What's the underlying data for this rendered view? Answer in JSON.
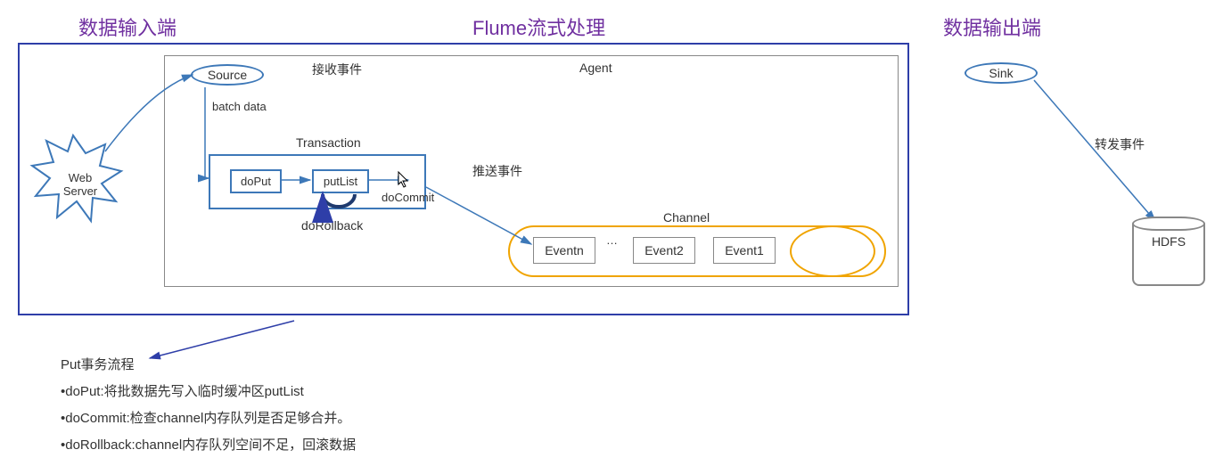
{
  "headers": {
    "input": "数据输入端",
    "center": "Flume流式处理",
    "output": "数据输出端"
  },
  "agent": {
    "label": "Agent",
    "source": "Source",
    "receive": "接收事件",
    "batch": "batch data",
    "sink": "Sink",
    "forward": "转发事件"
  },
  "txn": {
    "title": "Transaction",
    "doPut": "doPut",
    "putList": "putList",
    "doCommit": "doCommit",
    "doRollback": "doRollback",
    "push": "推送事件"
  },
  "channel": {
    "label": "Channel",
    "events": [
      "Eventn",
      "Event2",
      "Event1"
    ],
    "dots": "…"
  },
  "web": {
    "label1": "Web",
    "label2": "Server"
  },
  "hdfs": "HDFS",
  "notes": {
    "title": "Put事务流程",
    "l1": "•doPut:将批数据先写入临时缓冲区putList",
    "l2": "•doCommit:检查channel内存队列是否足够合并。",
    "l3": "•doRollback:channel内存队列空间不足，回滚数据"
  }
}
